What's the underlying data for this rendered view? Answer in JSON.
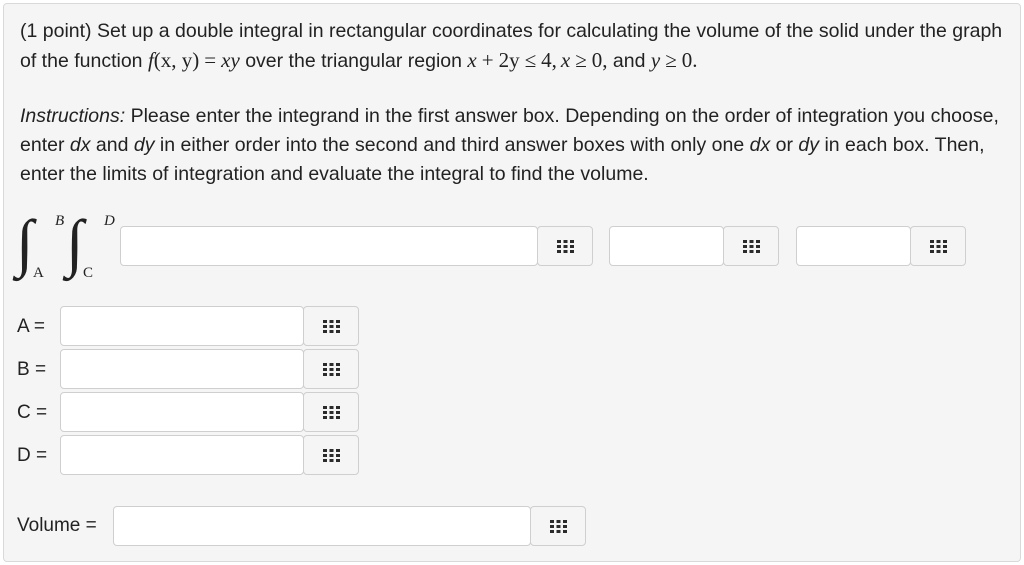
{
  "problem": {
    "points": "(1 point)",
    "text_a": "Set up a double integral in rectangular coordinates for calculating the volume of the solid under the graph of the function",
    "func_f": "f",
    "func_args": "(x, y)",
    "eq": "=",
    "func_rhs": "xy",
    "text_b": "over the triangular region",
    "region_lhs": "x",
    "plus": "+",
    "region_2y": "2y",
    "leq": "≤",
    "four": "4,",
    "x2": "x",
    "geq": "≥",
    "zero1": "0,",
    "and_text": "and",
    "y2": "y",
    "geq2": "≥",
    "zero2": "0."
  },
  "instructions": {
    "label": "Instructions:",
    "t1": "Please enter the integrand in the first answer box. Depending on the order of integration you choose, enter",
    "dx": "dx",
    "and1": "and",
    "dy": "dy",
    "t2": "in either order into the second and third answer boxes with only one",
    "dx2": "dx",
    "or": "or",
    "dy2": "dy",
    "t3": "in each box. Then, enter the limits of integration and evaluate the integral to find the volume."
  },
  "integral": {
    "upper_outer": "B",
    "lower_outer": "A",
    "upper_inner": "D",
    "lower_inner": "C",
    "sign": "∫"
  },
  "fields": {
    "integrand": "",
    "diff1": "",
    "diff2": "",
    "A": "",
    "B": "",
    "C": "",
    "D": "",
    "volume": ""
  },
  "labels": {
    "A": "A =",
    "B": "B =",
    "C": "C =",
    "D": "D =",
    "volume": "Volume ="
  },
  "icons": {
    "equation_editor": "grid-icon"
  }
}
